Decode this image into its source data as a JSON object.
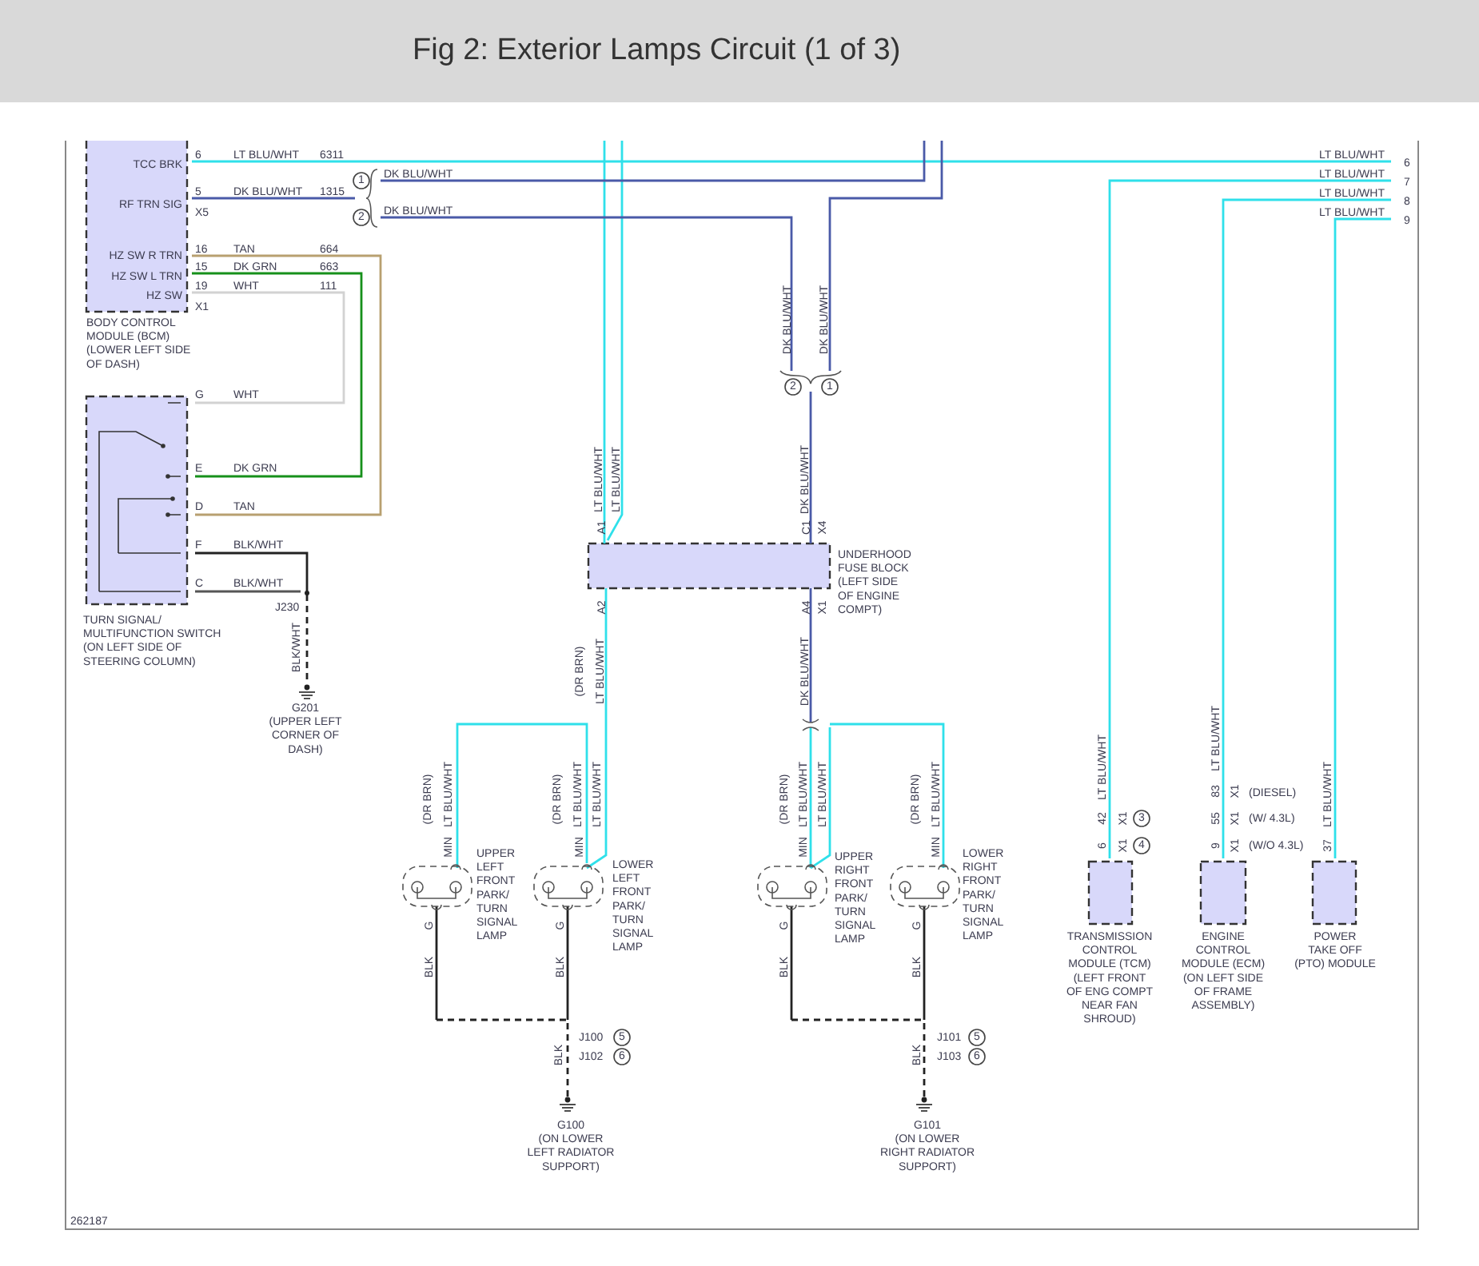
{
  "page": {
    "title": "Fig 2: Exterior Lamps Circuit (1 of 3)"
  },
  "diagram": {
    "texts": [
      "TCC BRK",
      "RF TRN SIG",
      "HZ SW R TRN",
      "HZ SW L TRN",
      "HZ SW",
      "6",
      "5",
      "X5",
      "16",
      "15",
      "19",
      "X1",
      "LT BLU/WHT",
      "6311",
      "DK BLU/WHT",
      "1315",
      "TAN",
      "664",
      "DK GRN",
      "663",
      "WHT",
      "111",
      "DK BLU/WHT",
      "DK BLU/WHT",
      "G",
      "WHT",
      "E",
      "DK GRN",
      "D",
      "TAN",
      "F",
      "BLK/WHT",
      "C",
      "BLK/WHT",
      "J230",
      "LT BLU/WHT",
      "6",
      "LT BLU/WHT",
      "7",
      "LT BLU/WHT",
      "8",
      "LT BLU/WHT",
      "9",
      "J100",
      "J102",
      "J101",
      "J103",
      "(DIESEL)",
      "(W/ 4.3L)",
      "(W/O 4.3L)",
      "262187"
    ],
    "vertical_texts": [
      "DK BLU/WHT",
      "DK BLU/WHT",
      "A1",
      "C1",
      "X4",
      "A2",
      "A4",
      "X1",
      "LT BLU/WHT",
      "LT BLU/WHT",
      "DK BLU/WHT",
      "BLK/WHT",
      "(DR BRN)",
      "LT BLU/WHT",
      "DK BLU/WHT",
      "(DR BRN)",
      "LT BLU/WHT",
      "(DR BRN)",
      "LT BLU/WHT",
      "LT BLU/WHT",
      "(DR BRN)",
      "LT BLU/WHT",
      "LT BLU/WHT",
      "(DR BRN)",
      "LT BLU/WHT",
      "MIN",
      "MIN",
      "MIN",
      "MIN",
      "G",
      "G",
      "G",
      "G",
      "BLK",
      "BLK",
      "BLK",
      "BLK",
      "BLK",
      "BLK",
      "LT BLU/WHT",
      "LT BLU/WHT",
      "LT BLU/WHT",
      "42",
      "X1",
      "6",
      "X1",
      "83",
      "X1",
      "55",
      "X1",
      "9",
      "X1",
      "37"
    ],
    "blocks": [
      {
        "lines": [
          "BODY CONTROL",
          "MODULE (BCM)",
          "(LOWER LEFT SIDE",
          "OF DASH)"
        ]
      },
      {
        "lines": [
          "TURN SIGNAL/",
          "MULTIFUNCTION SWITCH",
          "(ON LEFT SIDE OF",
          "STEERING COLUMN)"
        ]
      },
      {
        "lines": [
          "G201",
          "(UPPER LEFT",
          "CORNER OF",
          "DASH)"
        ]
      },
      {
        "lines": [
          "UNDERHOOD",
          "FUSE BLOCK",
          "(LEFT SIDE",
          "OF ENGINE",
          "COMPT)"
        ]
      },
      {
        "lines": [
          "UPPER",
          "LEFT",
          "FRONT",
          "PARK/",
          "TURN",
          "SIGNAL",
          "LAMP"
        ]
      },
      {
        "lines": [
          "LOWER",
          "LEFT",
          "FRONT",
          "PARK/",
          "TURN",
          "SIGNAL",
          "LAMP"
        ]
      },
      {
        "lines": [
          "UPPER",
          "RIGHT",
          "FRONT",
          "PARK/",
          "TURN",
          "SIGNAL",
          "LAMP"
        ]
      },
      {
        "lines": [
          "LOWER",
          "RIGHT",
          "FRONT",
          "PARK/",
          "TURN",
          "SIGNAL",
          "LAMP"
        ]
      },
      {
        "lines": [
          "G100",
          "(ON LOWER",
          "LEFT RADIATOR",
          "SUPPORT)"
        ]
      },
      {
        "lines": [
          "G101",
          "(ON LOWER",
          "RIGHT RADIATOR",
          "SUPPORT)"
        ]
      },
      {
        "lines": [
          "TRANSMISSION",
          "CONTROL",
          "MODULE (TCM)",
          "(LEFT FRONT",
          "OF ENG COMPT",
          "NEAR FAN",
          "SHROUD)"
        ]
      },
      {
        "lines": [
          "ENGINE",
          "CONTROL",
          "MODULE (ECM)",
          "(ON LEFT SIDE",
          "OF FRAME",
          "ASSEMBLY)"
        ]
      },
      {
        "lines": [
          "POWER",
          "TAKE OFF",
          "(PTO) MODULE"
        ]
      }
    ],
    "callouts": [
      "1",
      "2",
      "2",
      "1",
      "3",
      "4",
      "5",
      "6",
      "5",
      "6"
    ]
  }
}
